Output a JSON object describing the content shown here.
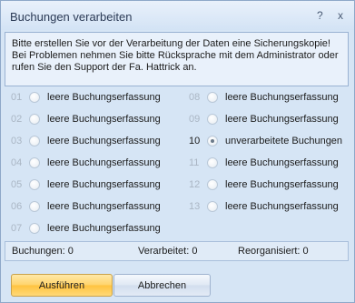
{
  "window": {
    "title": "Buchungen verarbeiten",
    "help_label": "?",
    "close_label": "x"
  },
  "info": {
    "line1": "Bitte erstellen Sie vor der Verarbeitung der Daten eine Sicherungskopie!",
    "line2": "Bei Problemen nehmen Sie bitte Rücksprache mit dem Administrator oder",
    "line3": "rufen Sie den Support der Fa. Hattrick an."
  },
  "options": [
    {
      "num": "01",
      "label": "leere Buchungserfassung",
      "checked": false
    },
    {
      "num": "02",
      "label": "leere Buchungserfassung",
      "checked": false
    },
    {
      "num": "03",
      "label": "leere Buchungserfassung",
      "checked": false
    },
    {
      "num": "04",
      "label": "leere Buchungserfassung",
      "checked": false
    },
    {
      "num": "05",
      "label": "leere Buchungserfassung",
      "checked": false
    },
    {
      "num": "06",
      "label": "leere Buchungserfassung",
      "checked": false
    },
    {
      "num": "07",
      "label": "leere Buchungserfassung",
      "checked": false
    },
    {
      "num": "08",
      "label": "leere Buchungserfassung",
      "checked": false
    },
    {
      "num": "09",
      "label": "leere Buchungserfassung",
      "checked": false
    },
    {
      "num": "10",
      "label": "unverarbeitete Buchungen",
      "checked": true
    },
    {
      "num": "11",
      "label": "leere Buchungserfassung",
      "checked": false
    },
    {
      "num": "12",
      "label": "leere Buchungserfassung",
      "checked": false
    },
    {
      "num": "13",
      "label": "leere Buchungserfassung",
      "checked": false
    }
  ],
  "status": {
    "buchungen": "Buchungen:  0",
    "verarbeitet": "Verarbeitet:  0",
    "reorganisiert": "Reorganisiert:  0"
  },
  "buttons": {
    "execute_label": "Ausführen",
    "cancel_label": "Abbrechen"
  },
  "colors": {
    "window_bg": "#d6e5f5",
    "accent_button": "#ffd36a"
  }
}
